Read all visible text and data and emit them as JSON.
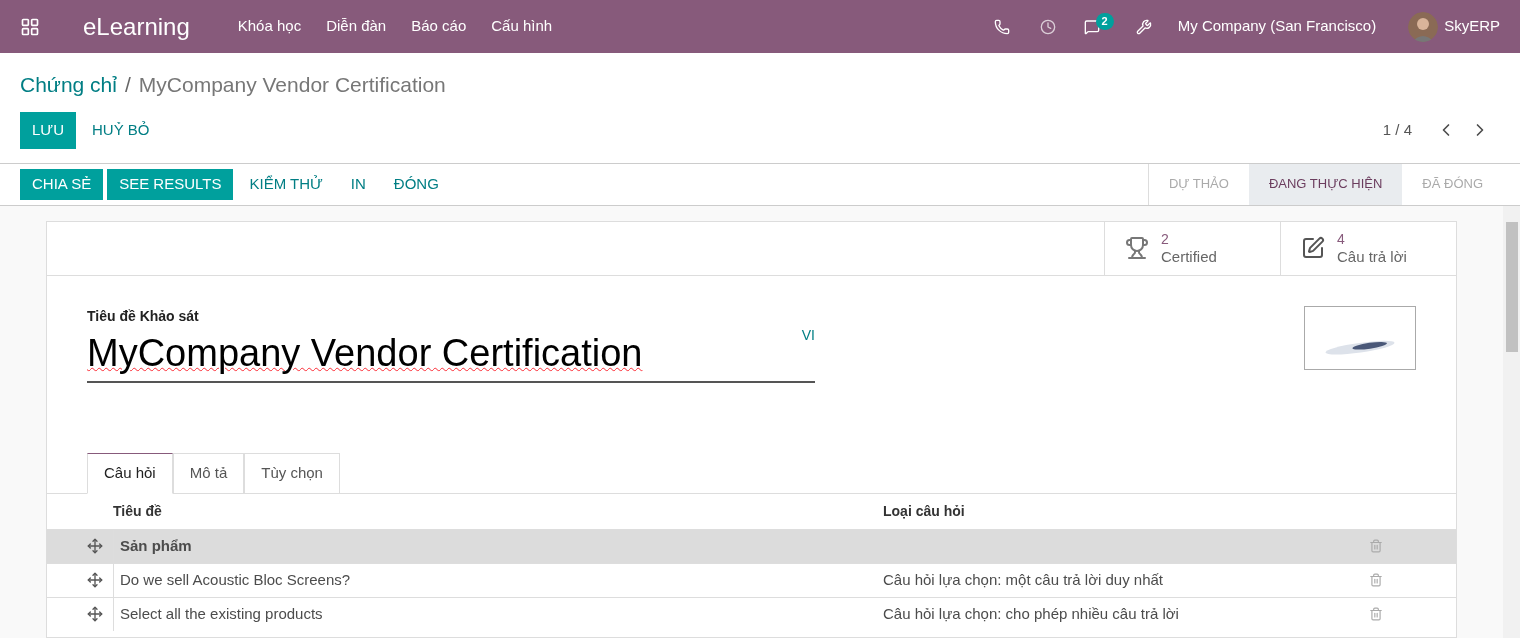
{
  "navbar": {
    "app": "eLearning",
    "menu": [
      "Khóa học",
      "Diễn đàn",
      "Báo cáo",
      "Cấu hình"
    ],
    "messages_badge": "2",
    "company": "My Company (San Francisco)",
    "user": "SkyERP"
  },
  "breadcrumb": {
    "parent": "Chứng chỉ",
    "separator": "/",
    "current": "MyCompany Vendor Certification"
  },
  "edit_buttons": [
    {
      "label": "LƯU",
      "primary": true
    },
    {
      "label": "HUỶ BỎ",
      "primary": false
    }
  ],
  "pager": "1 / 4",
  "actions": [
    {
      "label": "CHIA SẺ",
      "primary": true
    },
    {
      "label": "SEE RESULTS",
      "primary": true
    },
    {
      "label": "KIỂM THỬ",
      "primary": false
    },
    {
      "label": "IN",
      "primary": false
    },
    {
      "label": "ĐÓNG",
      "primary": false
    }
  ],
  "stages": [
    {
      "label": "DỰ THẢO",
      "selected": false
    },
    {
      "label": "ĐANG THỰC HIỆN",
      "selected": true
    },
    {
      "label": "ĐÃ ĐÓNG",
      "selected": false
    }
  ],
  "stat_buttons": [
    {
      "kind": "trophy",
      "value": "2",
      "label": "Certified"
    },
    {
      "kind": "edit",
      "value": "4",
      "label": "Câu trả lời"
    }
  ],
  "title_field": {
    "label": "Tiêu đề Khảo sát",
    "value": "MyCompany Vendor Certification",
    "lang": "VI"
  },
  "tabs": [
    {
      "label": "Câu hỏi",
      "selected": true
    },
    {
      "label": "Mô tả",
      "selected": false
    },
    {
      "label": "Tùy chọn",
      "selected": false
    }
  ],
  "table": {
    "columns": [
      "Tiêu đề",
      "Loại câu hỏi"
    ],
    "rows": [
      {
        "kind": "section",
        "title": "Sản phẩm"
      },
      {
        "kind": "question",
        "title": "Do we sell Acoustic Bloc Screens?",
        "type": "Câu hỏi lựa chọn: một câu trả lời duy nhất"
      },
      {
        "kind": "question",
        "title": "Select all the existing products",
        "type": "Câu hỏi lựa chọn: cho phép nhiều câu trả lời"
      }
    ]
  }
}
